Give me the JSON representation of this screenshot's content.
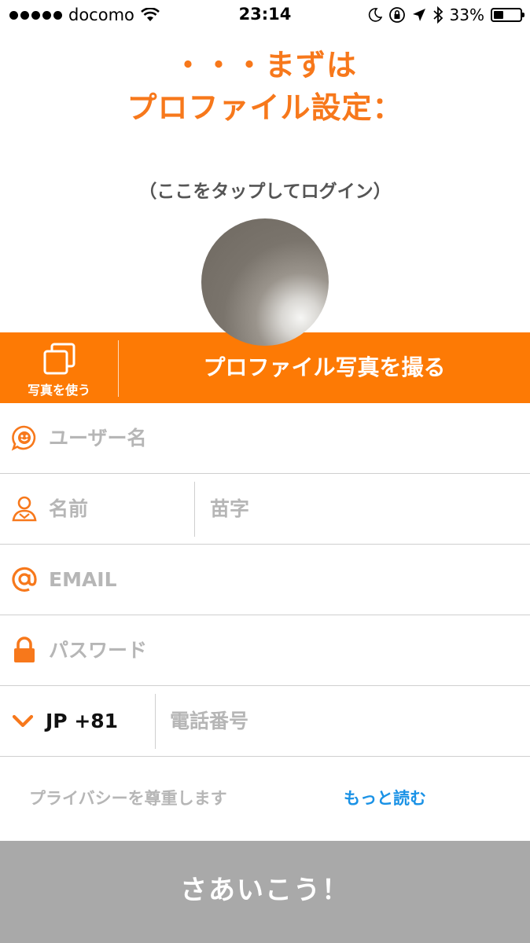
{
  "status_bar": {
    "carrier": "docomo",
    "time": "23:14",
    "battery_percent": "33%",
    "battery_level": 0.33,
    "icons": [
      "signal-dots-icon",
      "wifi-icon",
      "moon-icon",
      "rotation-lock-icon",
      "location-arrow-icon",
      "bluetooth-icon",
      "battery-icon"
    ]
  },
  "heading": {
    "line1": "・・・まずは",
    "line2": "プロファイル設定："
  },
  "avatar_hint": "（ここをタップしてログイン）",
  "photo_bar": {
    "use_photo_label": "写真を使う",
    "take_photo_label": "プロファイル写真を撮る",
    "background_color": "#fd7a05"
  },
  "form": {
    "username_placeholder": "ユーザー名",
    "first_name_placeholder": "名前",
    "last_name_placeholder": "苗字",
    "email_placeholder": "EMAIL",
    "password_placeholder": "パスワード",
    "country_code": "JP +81",
    "phone_placeholder": "電話番号"
  },
  "privacy": {
    "text": "プライバシーを尊重します",
    "read_more": "もっと読む"
  },
  "submit_label": "さあいこう！",
  "colors": {
    "accent": "#f7781b",
    "link": "#1a92e6",
    "button_disabled": "#a9a9a9"
  }
}
